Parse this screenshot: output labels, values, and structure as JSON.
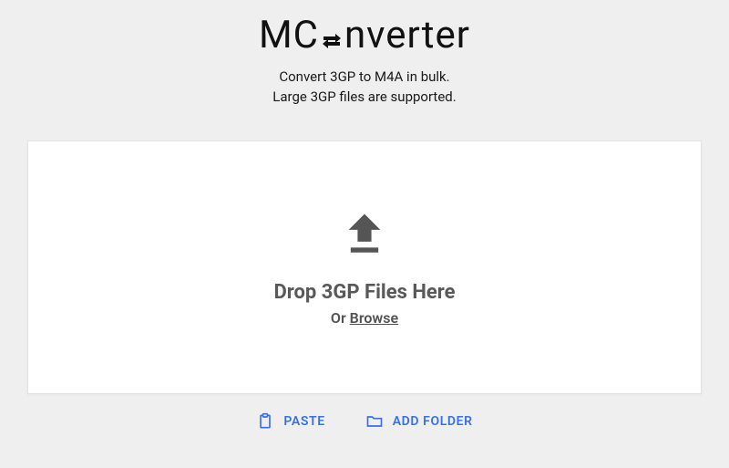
{
  "logo": {
    "pre": "MC",
    "post": "nverter"
  },
  "subtitle": {
    "line1": "Convert 3GP to M4A in bulk.",
    "line2": "Large 3GP files are supported."
  },
  "dropzone": {
    "heading": "Drop 3GP Files Here",
    "or": "Or ",
    "browse": "Browse"
  },
  "actions": {
    "paste": "PASTE",
    "add_folder": "ADD FOLDER"
  }
}
